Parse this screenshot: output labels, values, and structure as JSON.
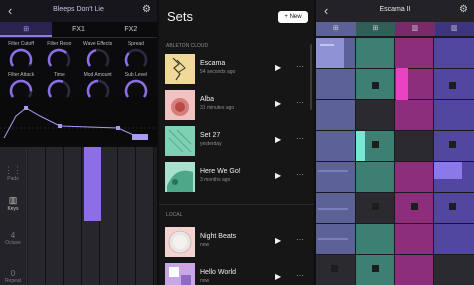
{
  "synth": {
    "title": "Bleeps Don't Lie",
    "tabs": [
      "FX1",
      "FX2"
    ],
    "knobs": [
      "Filter Cutoff",
      "Filter Reso",
      "Wave Effects",
      "Spread",
      "Filter Attack",
      "Time",
      "Mod Amount",
      "Sub Level"
    ],
    "side_options": [
      "Pads",
      "Keys",
      "Octave",
      "Repeat"
    ],
    "octave_value": "4",
    "repeat_value": "0"
  },
  "sets": {
    "title": "Sets",
    "new_label": "+ New",
    "cloud_label": "ABLETON CLOUD",
    "local_label": "LOCAL",
    "cloud_items": [
      {
        "name": "Escama",
        "time": "54 seconds ago"
      },
      {
        "name": "Alba",
        "time": "31 minutes ago"
      },
      {
        "name": "Set 27",
        "time": "yesterday"
      },
      {
        "name": "Here We Go!",
        "time": "3 months ago"
      }
    ],
    "local_items": [
      {
        "name": "Night Beats",
        "time": "now"
      },
      {
        "name": "Hello World",
        "time": "now"
      }
    ]
  },
  "session": {
    "title": "Escama II"
  },
  "colors": {
    "synth_accent": "#8c6fe6",
    "track_blue": "#5c6196",
    "track_teal": "#3e7f73",
    "track_magenta": "#8c2e7a",
    "track_purple": "#5146a0"
  }
}
